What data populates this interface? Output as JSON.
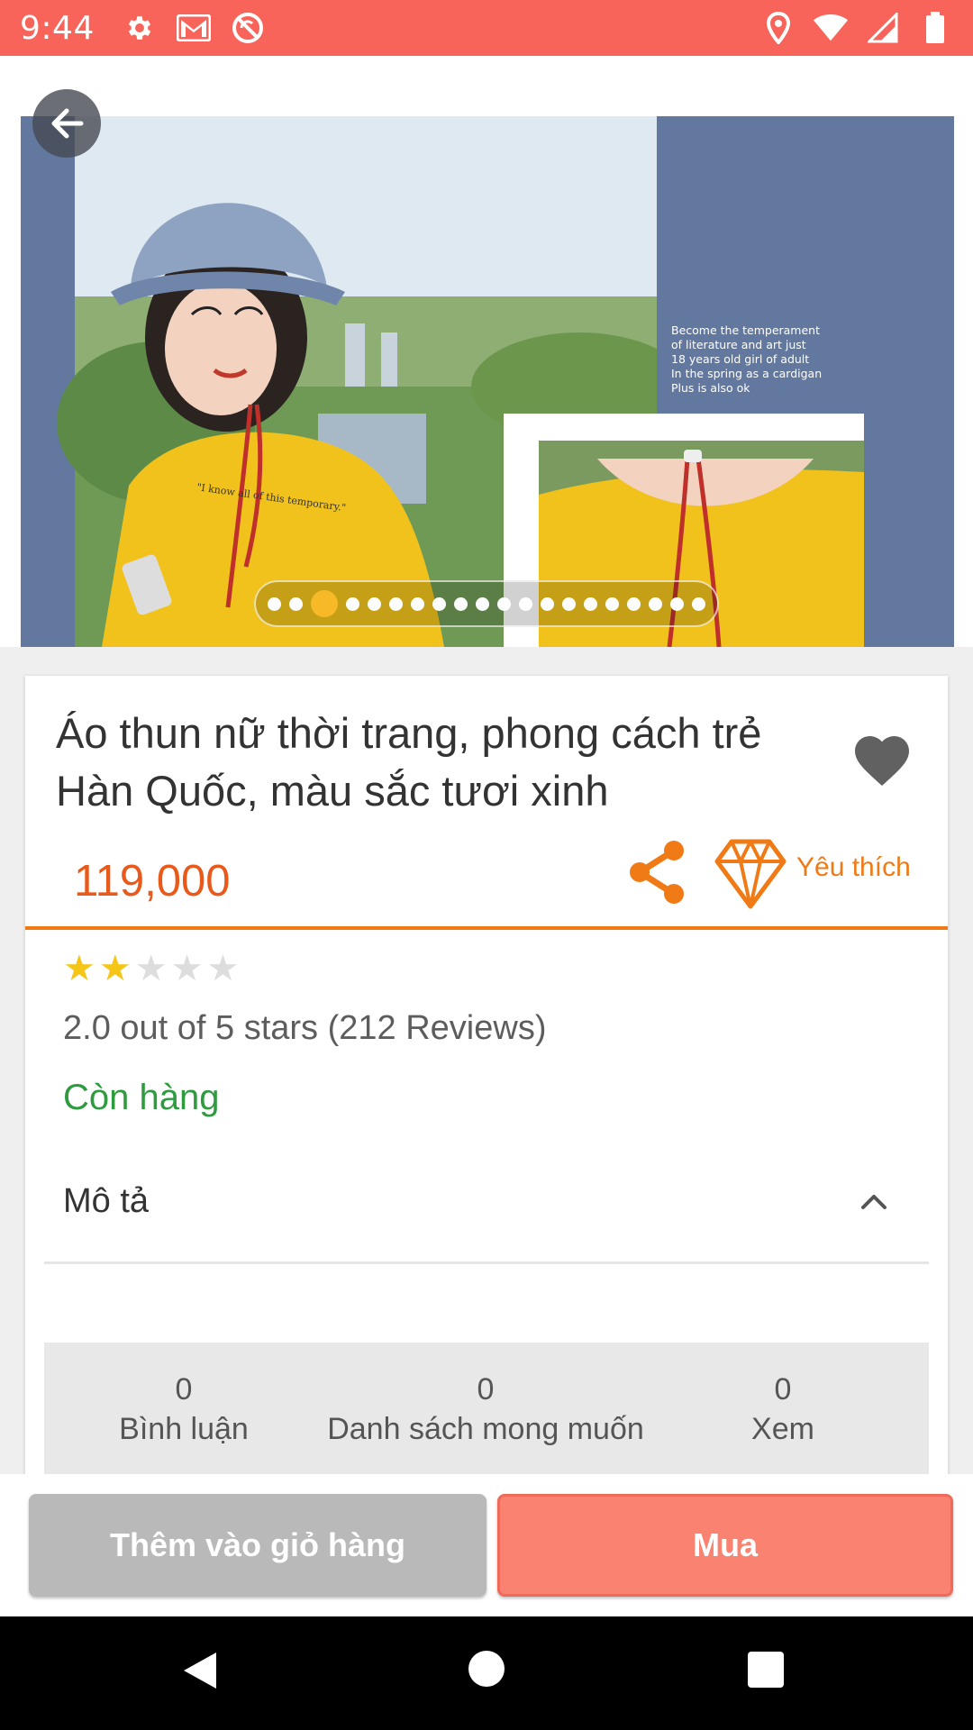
{
  "status_bar": {
    "time": "9:44",
    "bg_color": "#f8645a",
    "left_icons": [
      "settings-icon",
      "gmail-icon",
      "no-sync-icon"
    ],
    "right_icons": [
      "location-icon",
      "wifi-icon",
      "signal-icon",
      "battery-icon"
    ]
  },
  "hero": {
    "image_caption_lines": [
      "Become the temperament",
      "of literature and art just",
      "18 years old girl of adult",
      "In the spring as a cardigan",
      "Plus is also ok"
    ],
    "shirt_print_text": "\"I know all of this temporary.\"",
    "carousel_total": 20,
    "carousel_active_index": 2
  },
  "product": {
    "title": "Áo thun nữ thời trang, phong cách trẻ Hàn Quốc, màu sắc tươi xinh",
    "price": "119,000",
    "wish_label": "Yêu thích",
    "rating_value": 2,
    "rating_max": 5,
    "rating_text": "2.0 out of 5 stars (212 Reviews)",
    "stock_status": "Còn hàng",
    "description_label": "Mô tả"
  },
  "stats": [
    {
      "value": "0",
      "label": "Bình luận"
    },
    {
      "value": "0",
      "label": "Danh sách mong muốn"
    },
    {
      "value": "0",
      "label": "Xem"
    }
  ],
  "actions": {
    "add_to_cart": "Thêm vào giỏ hàng",
    "buy": "Mua"
  },
  "colors": {
    "accent_orange": "#ef7a16",
    "price_color": "#e8591a",
    "in_stock_green": "#2e9b3f",
    "buy_button": "#f98271"
  }
}
